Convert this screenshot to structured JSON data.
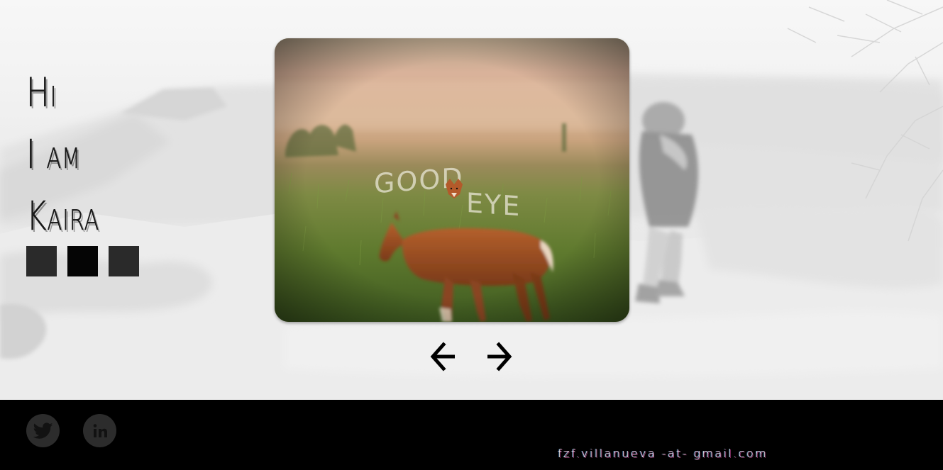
{
  "intro": {
    "lines": [
      "Hi",
      "I am",
      "Kaira"
    ]
  },
  "gallery": {
    "photo_text": "GOOD EYE",
    "squares_count": 3,
    "active_square": 2
  },
  "nav": {
    "prev_icon": "arrow-left-icon",
    "next_icon": "arrow-right-icon"
  },
  "footer": {
    "social": [
      {
        "name": "twitter",
        "icon": "twitter-icon"
      },
      {
        "name": "linkedin",
        "icon": "linkedin-icon"
      }
    ],
    "email": "fzf.villanueva -at- gmail.com"
  },
  "colors": {
    "footer_bg": "#000000",
    "square": "#2a2a2a",
    "square_active": "#050505",
    "social_bg": "#2c2c2c"
  }
}
